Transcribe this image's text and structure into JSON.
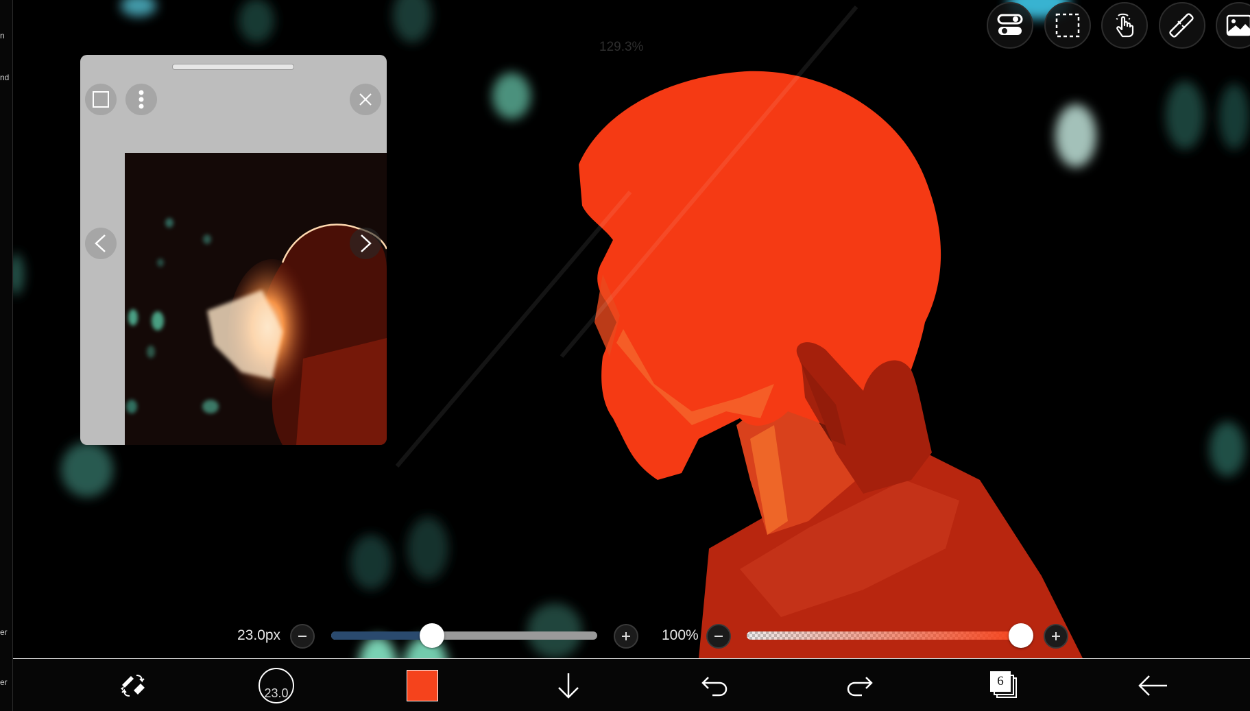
{
  "left_strip": {
    "fragments": [
      "n",
      "nd",
      "er",
      "er"
    ]
  },
  "canvas": {
    "zoom_label": "129.3%",
    "background_color": "#000000",
    "figure_color": "#f53a14"
  },
  "top_toolbar": {
    "icons": [
      "toggle-settings-icon",
      "selection-marquee-icon",
      "touch-gesture-icon",
      "ruler-icon",
      "reference-image-icon"
    ]
  },
  "reference_window": {
    "icons": [
      "window-square-icon",
      "more-vertical-icon",
      "close-icon",
      "chevron-left-icon",
      "chevron-right-icon"
    ]
  },
  "brush_size": {
    "value_text": "23.0px",
    "level_fraction": 0.38
  },
  "brush_opacity": {
    "value_text": "100%",
    "level_fraction": 1.0
  },
  "bottom_bar": {
    "brush_preview_label": "23.0",
    "current_color": "#f5431c",
    "layer_count": "6",
    "icons": [
      "brush-eraser-swap-icon",
      "brush-size-preview-icon",
      "color-swatch-icon",
      "download-icon",
      "undo-icon",
      "redo-icon",
      "layers-icon",
      "back-icon"
    ]
  }
}
